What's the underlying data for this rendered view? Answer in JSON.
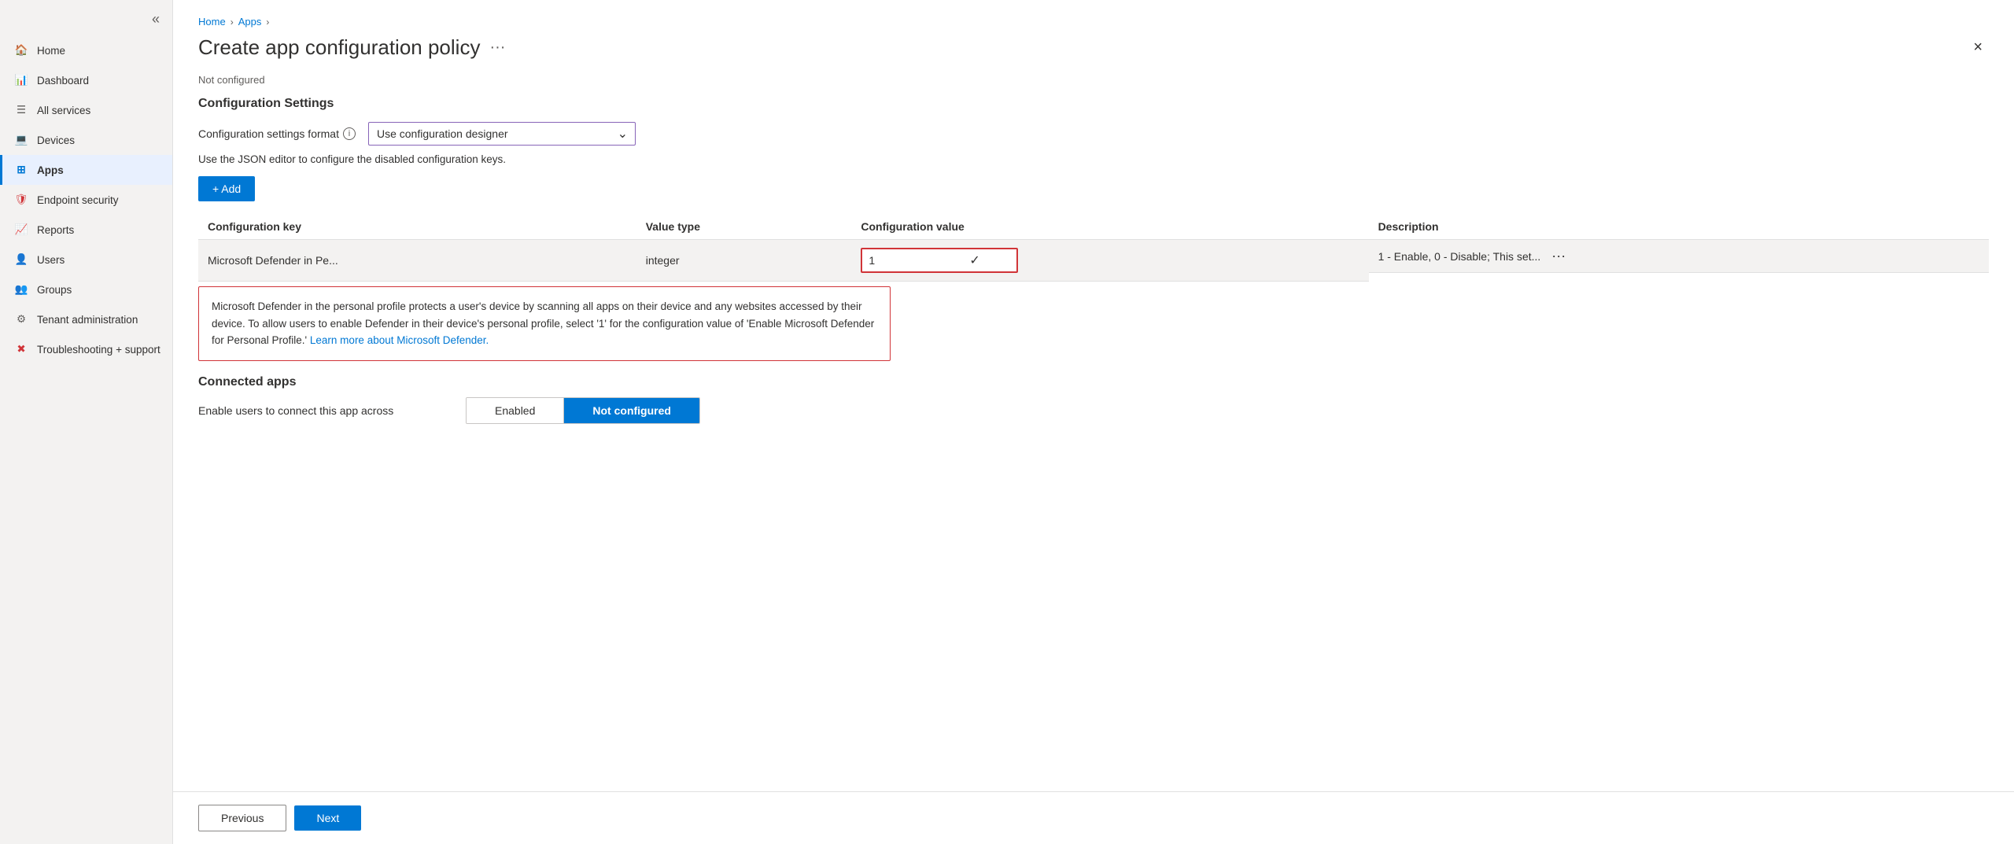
{
  "sidebar": {
    "collapse_icon": "«",
    "items": [
      {
        "id": "home",
        "label": "Home",
        "icon": "🏠",
        "icon_class": "icon-home",
        "active": false
      },
      {
        "id": "dashboard",
        "label": "Dashboard",
        "icon": "📊",
        "icon_class": "icon-dashboard",
        "active": false
      },
      {
        "id": "all-services",
        "label": "All services",
        "icon": "☰",
        "icon_class": "icon-services",
        "active": false
      },
      {
        "id": "devices",
        "label": "Devices",
        "icon": "💻",
        "icon_class": "icon-devices",
        "active": false
      },
      {
        "id": "apps",
        "label": "Apps",
        "icon": "⊞",
        "icon_class": "icon-apps",
        "active": true
      },
      {
        "id": "endpoint-security",
        "label": "Endpoint security",
        "icon": "🛡",
        "icon_class": "icon-endpoint",
        "active": false
      },
      {
        "id": "reports",
        "label": "Reports",
        "icon": "📈",
        "icon_class": "icon-reports",
        "active": false
      },
      {
        "id": "users",
        "label": "Users",
        "icon": "👤",
        "icon_class": "icon-users",
        "active": false
      },
      {
        "id": "groups",
        "label": "Groups",
        "icon": "👥",
        "icon_class": "icon-groups",
        "active": false
      },
      {
        "id": "tenant-admin",
        "label": "Tenant administration",
        "icon": "⚙",
        "icon_class": "icon-tenant",
        "active": false
      },
      {
        "id": "troubleshooting",
        "label": "Troubleshooting + support",
        "icon": "✖",
        "icon_class": "icon-trouble",
        "active": false
      }
    ]
  },
  "breadcrumb": {
    "items": [
      "Home",
      "Apps"
    ],
    "separators": [
      ">",
      ">"
    ]
  },
  "page": {
    "title": "Create app configuration policy",
    "more_icon": "···",
    "close_icon": "×"
  },
  "content": {
    "not_configured_label": "Not configured",
    "configuration_settings_title": "Configuration Settings",
    "format_label": "Configuration settings format",
    "format_info": "i",
    "format_value": "Use configuration designer",
    "json_hint": "Use the JSON editor to configure the disabled configuration keys.",
    "add_button": "+ Add",
    "table": {
      "headers": [
        "Configuration key",
        "Value type",
        "Configuration value",
        "Description"
      ],
      "rows": [
        {
          "key": "Microsoft Defender in Pe...",
          "value_type": "integer",
          "config_value": "1",
          "description": "1 - Enable, 0 - Disable; This set..."
        }
      ]
    },
    "description_box": {
      "text_before_link": "Microsoft Defender in the personal profile protects a user's device by scanning all apps on their device and any websites accessed by their device. To allow users to enable Defender in their device's personal profile, select '1' for the configuration value of 'Enable Microsoft Defender for Personal Profile.'",
      "link_text": "Learn more about Microsoft Defender.",
      "link_href": "#"
    },
    "connected_apps": {
      "title": "Connected apps",
      "toggle_label": "Enable users to connect this app across",
      "options": [
        "Enabled",
        "Not configured"
      ],
      "active_option": "Not configured"
    }
  },
  "footer": {
    "previous_label": "Previous",
    "next_label": "Next"
  }
}
